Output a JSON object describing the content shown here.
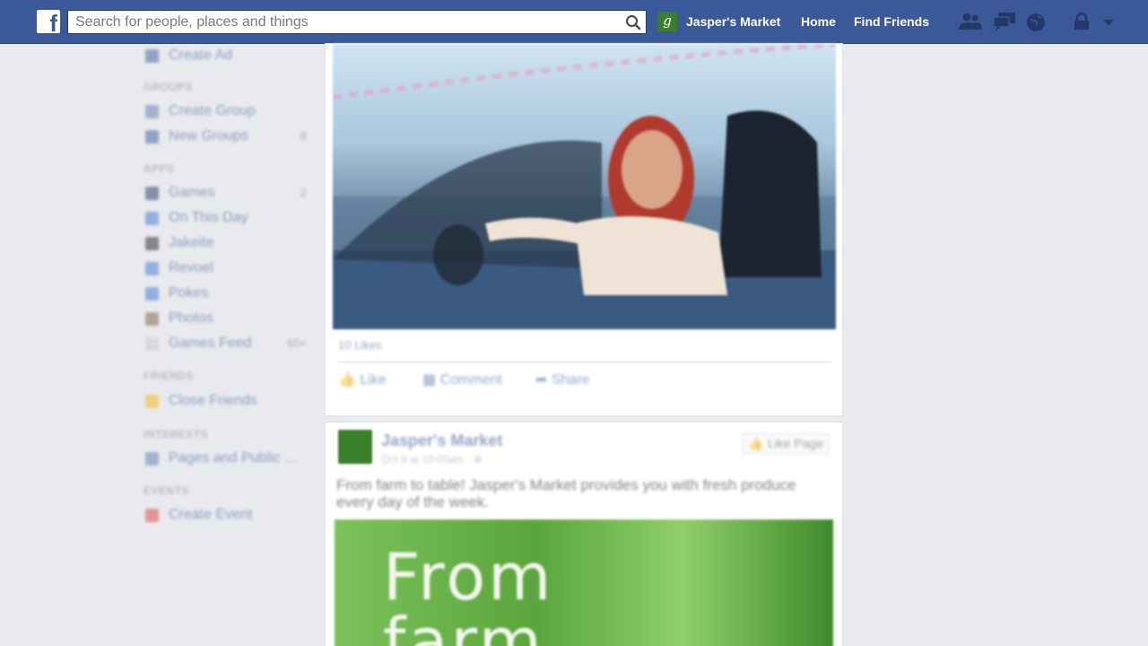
{
  "topbar": {
    "logo": "f",
    "search_placeholder": "Search for people, places and things",
    "page_name": "Jasper's Market",
    "page_initial": "g",
    "home": "Home",
    "find_friends": "Find Friends",
    "icons": [
      "friend-requests-icon",
      "messages-icon",
      "notifications-icon",
      "privacy-shortcuts-icon",
      "account-menu-icon"
    ]
  },
  "sidebar": {
    "items_top": [
      {
        "label": "Create Ad",
        "color": "#4a67a8"
      }
    ],
    "groups_heading": "GROUPS",
    "groups": [
      {
        "label": "Create Group",
        "color": "#6d84b4",
        "count": ""
      },
      {
        "label": "New Groups",
        "color": "#4a67a8",
        "count": "8"
      }
    ],
    "apps_heading": "APPS",
    "apps": [
      {
        "label": "Games",
        "color": "#37456a",
        "count": "2"
      },
      {
        "label": "On This Day",
        "color": "#4a7fd6",
        "count": ""
      },
      {
        "label": "Jakeite",
        "color": "#333333",
        "count": ""
      },
      {
        "label": "Revoel",
        "color": "#4a7fd6",
        "count": ""
      },
      {
        "label": "Pokes",
        "color": "#4a7fd6",
        "count": ""
      },
      {
        "label": "Photos",
        "color": "#8a6a4a",
        "count": ""
      },
      {
        "label": "Games Feed",
        "color": "#c9ccd4",
        "count": "60+"
      }
    ],
    "friends_heading": "FRIENDS",
    "friends": [
      {
        "label": "Close Friends",
        "color": "#f0c020",
        "count": ""
      }
    ],
    "interests_heading": "INTERESTS",
    "interests": [
      {
        "label": "Pages and Public ...",
        "color": "#6d84b4",
        "count": ""
      }
    ],
    "events_heading": "EVENTS",
    "events": [
      {
        "label": "Create Event",
        "color": "#d9534f",
        "count": ""
      }
    ]
  },
  "feed": {
    "post1": {
      "likes": "10 Likes",
      "like": "Like",
      "comment": "Comment",
      "share": "Share"
    },
    "post2": {
      "name": "Jasper's Market",
      "time": "Oct 9 at 10:00am · ⊕",
      "like_page": "Like Page",
      "text": "From farm to table! Jasper's Market provides you with fresh produce every day of the week.",
      "image_text": "From\nfarm"
    }
  }
}
